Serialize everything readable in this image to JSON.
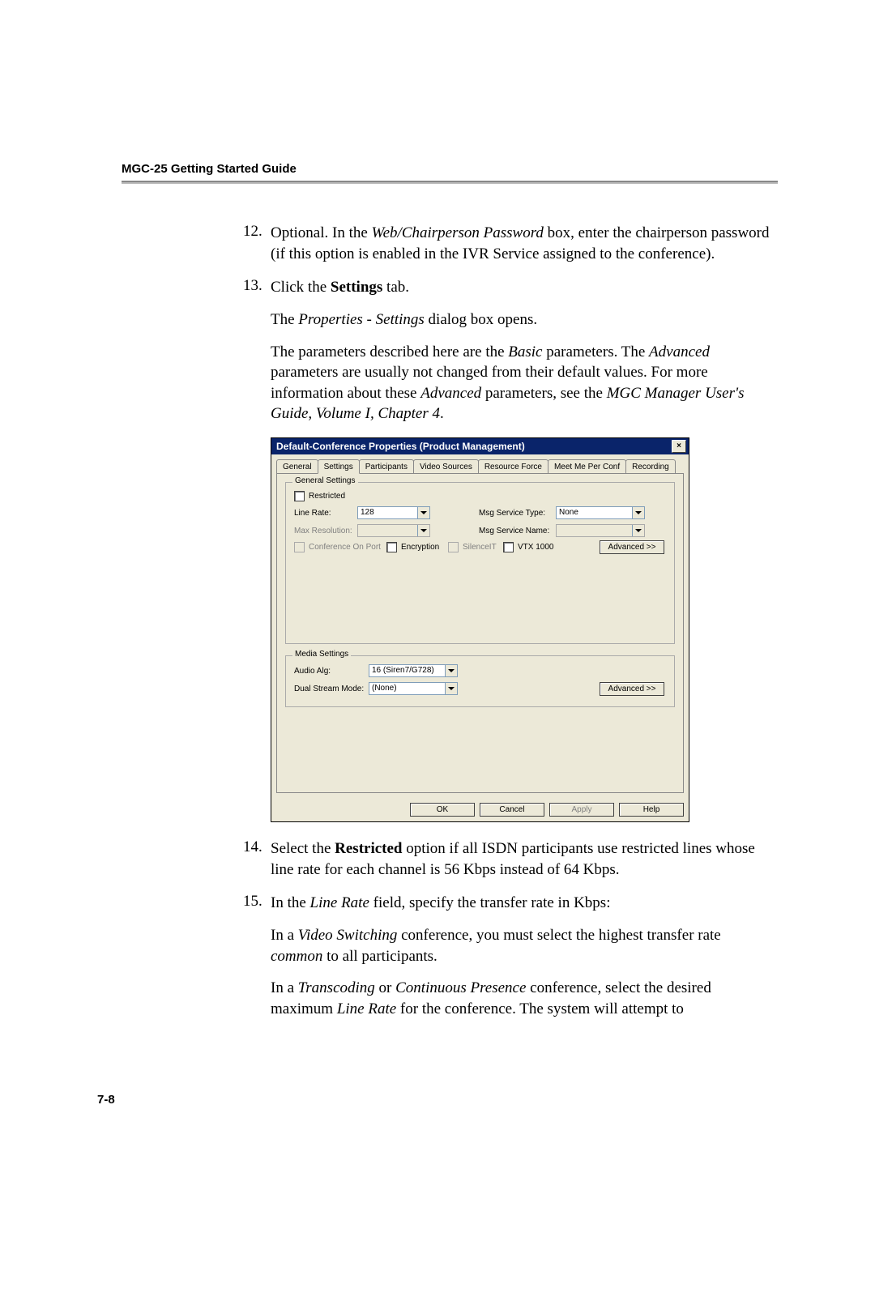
{
  "header": "MGC-25 Getting Started Guide",
  "steps": {
    "s12": {
      "num": "12.",
      "p1_a": "Optional. In the ",
      "p1_b": "Web/Chairperson Password",
      "p1_c": " box, enter the chairperson password (if this option is enabled in the IVR Service assigned to the conference)."
    },
    "s13": {
      "num": "13.",
      "p1_a": "Click the ",
      "p1_b": "Settings",
      "p1_c": " tab.",
      "p2_a": "The ",
      "p2_b": "Properties - Settings",
      "p2_c": " dialog box opens.",
      "p3_a": "The parameters described here are the ",
      "p3_b": "Basic",
      "p3_c": " parameters. The ",
      "p3_d": "Advanced",
      "p3_e": " parameters are usually not changed from their default values. For more information about these ",
      "p3_f": "Advanced",
      "p3_g": " parameters, see the ",
      "p3_h": "MGC Manager User's Guide, Volume I, Chapter 4",
      "p3_i": "."
    },
    "s14": {
      "num": "14.",
      "p1_a": "Select the ",
      "p1_b": "Restricted",
      "p1_c": " option if all ISDN participants use restricted lines whose line rate for each channel is 56 Kbps instead of 64 Kbps."
    },
    "s15": {
      "num": "15.",
      "p1_a": "In the ",
      "p1_b": "Line Rate",
      "p1_c": " field, specify the transfer rate in Kbps:",
      "p2_a": "In a ",
      "p2_b": "Video Switching",
      "p2_c": " conference, you must select the highest transfer rate ",
      "p2_d": "common",
      "p2_e": " to all participants.",
      "p3_a": "In a ",
      "p3_b": "Transcoding",
      "p3_c": " or ",
      "p3_d": "Continuous Presence",
      "p3_e": " conference, select the desired maximum ",
      "p3_f": "Line Rate",
      "p3_g": " for the conference. The system will attempt to"
    }
  },
  "dialog": {
    "title": "Default-Conference Properties  (Product Management)",
    "tabs": [
      "General",
      "Settings",
      "Participants",
      "Video Sources",
      "Resource Force",
      "Meet Me Per Conf",
      "Recording"
    ],
    "general_group": "General Settings",
    "restricted": "Restricted",
    "line_rate_label": "Line Rate:",
    "line_rate_value": "128",
    "max_res_label": "Max Resolution:",
    "msg_type_label": "Msg Service Type:",
    "msg_type_value": "None",
    "msg_name_label": "Msg Service Name:",
    "conf_on_port": "Conference On Port",
    "encryption": "Encryption",
    "silenceit": "SilenceIT",
    "vtx1000": "VTX 1000",
    "advanced_btn": "Advanced >>",
    "media_group": "Media Settings",
    "audio_alg_label": "Audio Alg:",
    "audio_alg_value": "16 (Siren7/G728)",
    "dual_stream_label": "Dual Stream Mode:",
    "dual_stream_value": "(None)",
    "ok": "OK",
    "cancel": "Cancel",
    "apply": "Apply",
    "help": "Help"
  },
  "page_number": "7-8"
}
